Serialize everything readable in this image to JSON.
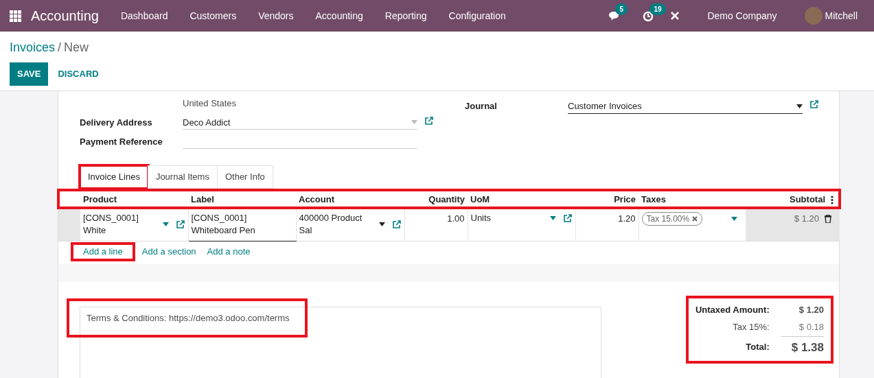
{
  "app": {
    "title": "Accounting"
  },
  "menu": [
    "Dashboard",
    "Customers",
    "Vendors",
    "Accounting",
    "Reporting",
    "Configuration"
  ],
  "systray": {
    "messages_count": "5",
    "activities_count": "19",
    "company": "Demo Company",
    "user": "Mitchell"
  },
  "breadcrumb": {
    "parent": "Invoices",
    "separator": "/",
    "current": "New"
  },
  "buttons": {
    "save": "SAVE",
    "discard": "DISCARD"
  },
  "address_lines": [
    "United States"
  ],
  "fields": [
    {
      "label": "Delivery Address",
      "value": "Deco Addict"
    },
    {
      "label": "Payment Reference"
    }
  ],
  "journal": {
    "label": "Journal",
    "value": "Customer Invoices"
  },
  "tabs": [
    {
      "label": "Invoice Lines",
      "selected": true,
      "highlighted": true
    },
    {
      "label": "Journal Items",
      "selected": false,
      "highlighted": false
    },
    {
      "label": "Other Info",
      "selected": false,
      "highlighted": false
    }
  ],
  "table": {
    "header_highlighted": true,
    "columns": [
      "Product",
      "Label",
      "Account",
      "Quantity",
      "UoM",
      "Price",
      "Taxes",
      "Subtotal"
    ],
    "rows": [
      {
        "product": "[CONS_0001] White",
        "label": "[CONS_0001] Whiteboard Pen",
        "account": "400000 Product Sal",
        "quantity": "1.00",
        "uom": "Units",
        "price": "1.20",
        "taxes": [
          "Tax 15.00%"
        ],
        "subtotal": "$ 1.20"
      }
    ]
  },
  "add_links": [
    {
      "label": "Add a line",
      "highlighted": true
    },
    {
      "label": "Add a section",
      "highlighted": false
    },
    {
      "label": "Add a note",
      "highlighted": false
    }
  ],
  "terms": {
    "text": "Terms & Conditions: https://demo3.odoo.com/terms",
    "highlighted": true
  },
  "totals": {
    "highlighted": true,
    "lines": [
      {
        "kind": "untaxed",
        "label": "Untaxed Amount:",
        "value": "$ 1.20"
      },
      {
        "kind": "tax",
        "label": "Tax 15%:",
        "value": "$ 0.18"
      },
      {
        "kind": "total",
        "label": "Total:",
        "value": "$ 1.38"
      }
    ]
  }
}
